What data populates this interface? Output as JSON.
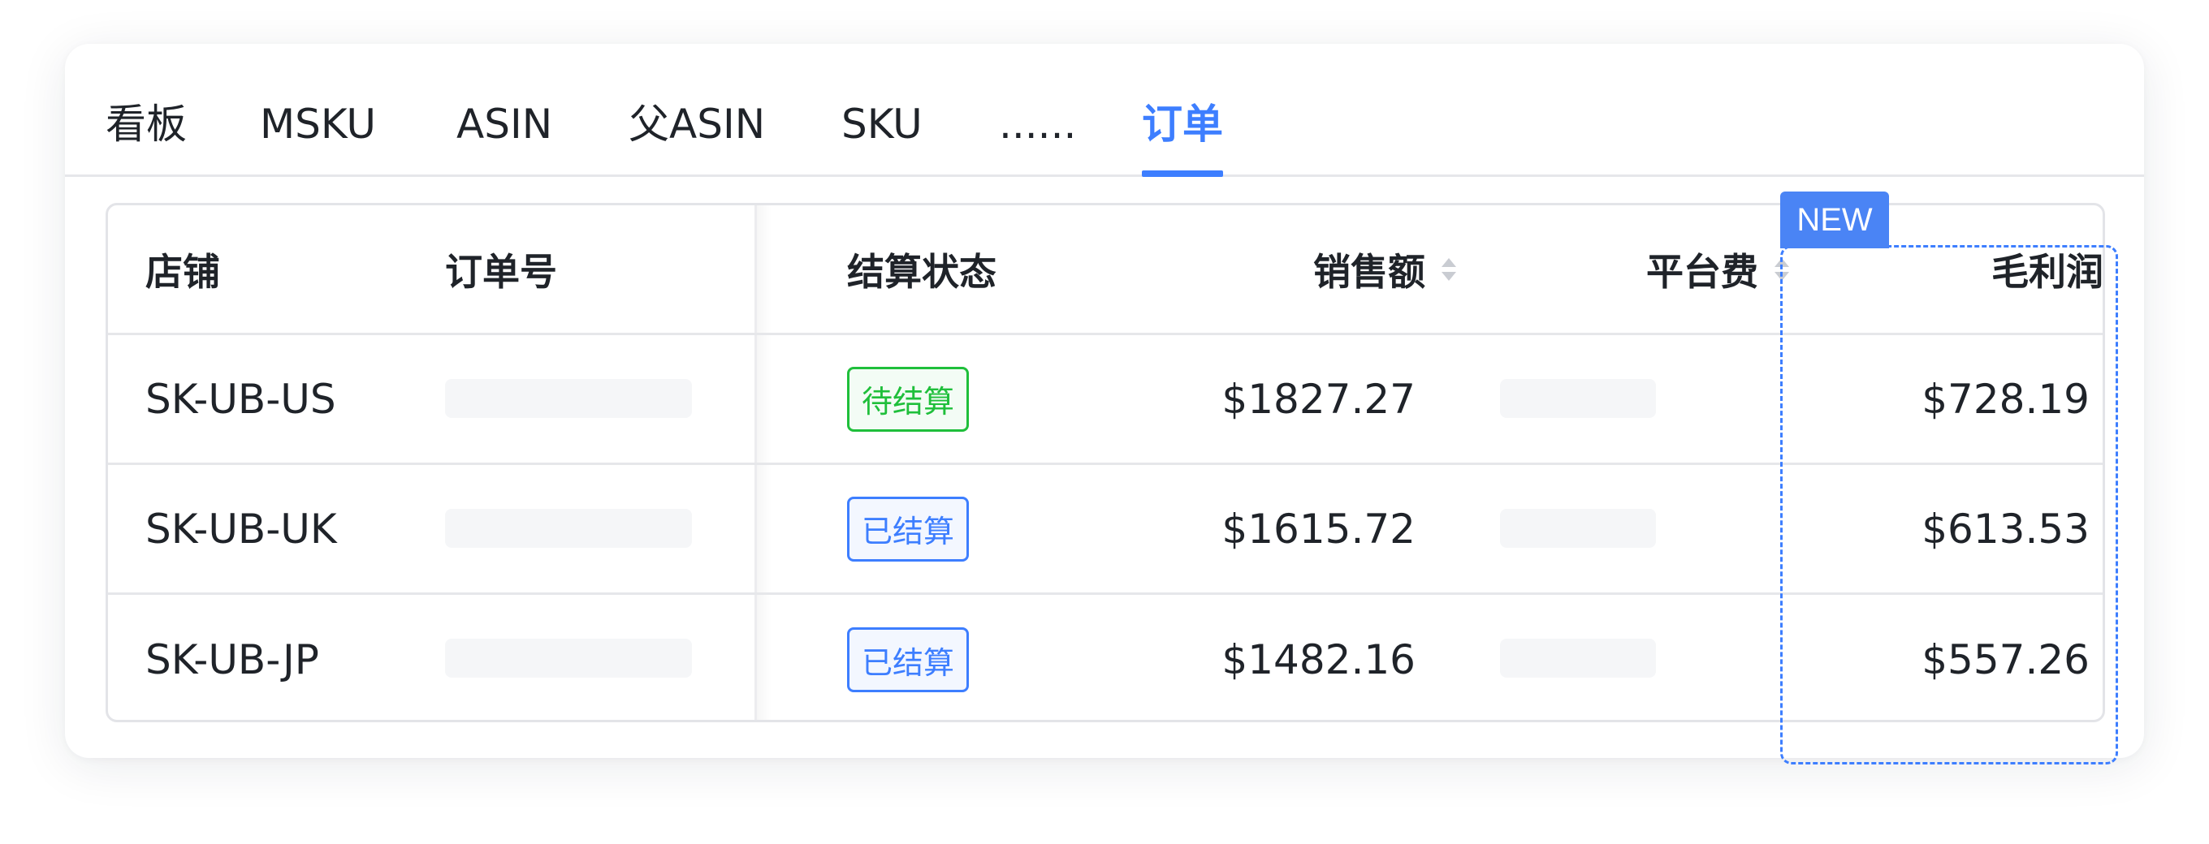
{
  "tabs": [
    {
      "label": "看板"
    },
    {
      "label": "MSKU"
    },
    {
      "label": "ASIN"
    },
    {
      "label": "父ASIN"
    },
    {
      "label": "SKU"
    },
    {
      "label": "......"
    },
    {
      "label": "订单",
      "active": true
    }
  ],
  "table": {
    "headers": {
      "shop": "店铺",
      "order_no": "订单号",
      "settle_status": "结算状态",
      "sales": "销售额",
      "platform_fee": "平台费",
      "gross_profit": "毛利润"
    },
    "sort": {
      "column": "gross_profit",
      "direction": "desc"
    },
    "rows": [
      {
        "shop": "SK-UB-US",
        "settle_status": "待结算",
        "status_type": "pending",
        "sales": "$1827.27",
        "gross_profit": "$728.19"
      },
      {
        "shop": "SK-UB-UK",
        "settle_status": "已结算",
        "status_type": "settled",
        "sales": "$1615.72",
        "gross_profit": "$613.53"
      },
      {
        "shop": "SK-UB-JP",
        "settle_status": "已结算",
        "status_type": "settled",
        "sales": "$1482.16",
        "gross_profit": "$557.26"
      }
    ]
  },
  "new_tag": "NEW",
  "colors": {
    "accent": "#3d7eff",
    "pending": "#1fbf3b",
    "settled": "#3d7eff"
  }
}
